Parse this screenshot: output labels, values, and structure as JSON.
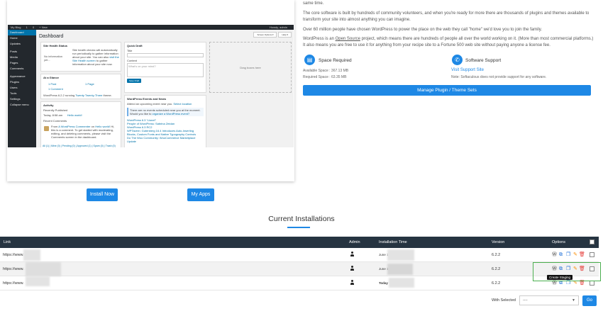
{
  "preview": {
    "topbar": [
      "My Blog",
      "1",
      "0",
      "+ New"
    ],
    "topbar_right": "Howdy, admin",
    "sidebar": [
      "Dashboard",
      "Home",
      "Updates",
      "Posts",
      "Media",
      "Pages",
      "Comments",
      "Appearance",
      "Plugins",
      "Users",
      "Tools",
      "Settings",
      "Collapse menu"
    ],
    "page_title": "Dashboard",
    "tabs": [
      "Screen Options ▾",
      "Help ▾"
    ],
    "site_health": {
      "title": "Site Health Status",
      "status": "No information yet...",
      "text": "Site health checks will automatically run periodically to gather information about your site. You can also",
      "link": "visit the Site Health screen",
      "text2": "to gather information about your site now."
    },
    "glance": {
      "title": "At a Glance",
      "post": "1 Post",
      "page": "1 Page",
      "comment": "1 Comment",
      "footer": "WordPress 6.2.2 running",
      "theme": "Twenty Twenty-Three",
      "footer2": "theme."
    },
    "activity": {
      "title": "Activity",
      "recent": "Recently Published",
      "date": "Today, 8:58 am",
      "post": "Hello world!",
      "comments_title": "Recent Comments",
      "comment_from": "From",
      "commenter": "A WordPress Commenter",
      "on": "on",
      "comment_post": "Hello world!",
      "comment_text": "Hi, this is a comment. To get started with moderating, editing, and deleting comments, please visit the Comments screen in the dashboard.",
      "filters": "All (1) | Mine (0) | Pending (0) | Approved (1) | Spam (0) | Trash (0)"
    },
    "quick_draft": {
      "title": "Quick Draft",
      "title_label": "Title",
      "content_label": "Content",
      "content_placeholder": "What's on your mind?",
      "save": "Save Draft"
    },
    "events": {
      "title": "WordPress Events and News",
      "intro": "Attend an upcoming event near you.",
      "select": "Select location",
      "notice": "There are no events scheduled near you at the moment. Would you like to",
      "notice_link": "organize a WordPress event?",
      "news": [
        "WordPress 6.3 “Lionel”",
        "People of WordPress: Sabrina Zeidan",
        "WordPress 6.3 RC2",
        "WPTavern: Gutenberg 16.4 Introduces Auto-Inserting Blocks, Custom Fonts and Native Typography Controls",
        "Do The Woo Community: WooCommerce Marketplace Update"
      ],
      "drop": "Drag boxes here"
    }
  },
  "buttons": {
    "install": "Install Now",
    "myapps": "My Apps"
  },
  "right": {
    "para1_tail": "same time.",
    "para2": "The core software is built by hundreds of community volunteers, and when you're ready for more there are thousands of plugins and themes available to transform your site into almost anything you can imagine.",
    "para3": "Over 60 million people have chosen WordPress to power the place on the web they call \"home\" we'd love you to join the family.",
    "para4_a": "WordPress is an",
    "para4_link": "Open Source",
    "para4_b": "project, which means there are hundreds of people all over the world working on it. (More than most commercial platforms.) It also means you are free to use it for anything from your recipe site to a Fortune 500 web site without paying anyone a license fee.",
    "space_title": "Space Required",
    "available": "Available Space : 367.13 MB",
    "required": "Required Space : 63.35 MB",
    "support_title": "Software Support",
    "support_link": "Visit Support Site",
    "support_note": "Note: Softaculous does not provide support for any software.",
    "manage": "Manage Plugin / Theme Sets"
  },
  "installations": {
    "title": "Current Installations",
    "headers": {
      "link": "Link",
      "admin": "Admin",
      "time": "Installation Time",
      "version": "Version",
      "options": "Options"
    },
    "rows": [
      {
        "link": "https://www.",
        "time": "June 1",
        "version": "6.2.2"
      },
      {
        "link": "https://www.",
        "time": "June 1",
        "version": "6.2.2"
      },
      {
        "link": "https://www.",
        "time": "Today",
        "version": "6.2.2"
      }
    ],
    "tooltip": "Create Staging",
    "with_selected": "With Selected",
    "select_value": "----",
    "go": "Go"
  },
  "colors": {
    "accent": "#1e88e5",
    "header": "#263441",
    "highlight": "#4caf50",
    "delete": "#e53935",
    "edit": "#fb8c00"
  },
  "icons": [
    "wordpress-icon",
    "staging-icon",
    "clone-icon",
    "edit-icon",
    "delete-icon",
    "user-icon",
    "storage-icon",
    "support-icon"
  ]
}
